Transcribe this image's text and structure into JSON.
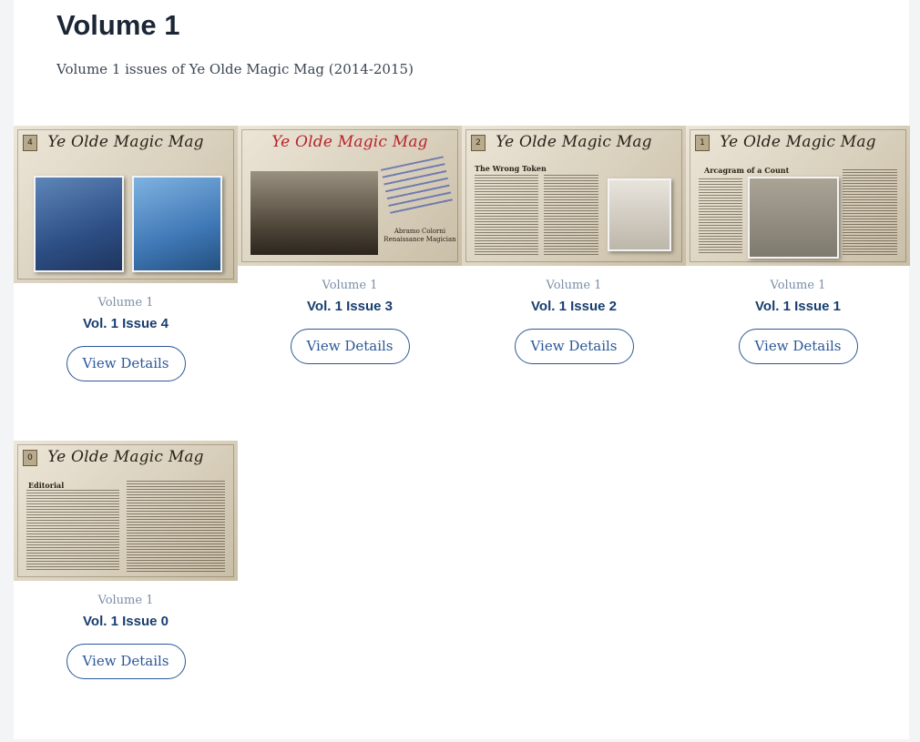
{
  "header": {
    "title": "Volume 1",
    "subtitle": "Volume 1 issues of Ye Olde Magic Mag (2014-2015)"
  },
  "cover_brand": "Ye Olde Magic Mag",
  "issues": [
    {
      "volume_label": "Volume 1",
      "title": "Vol. 1 Issue 4",
      "issue_number": "4",
      "button": "View Details"
    },
    {
      "volume_label": "Volume 1",
      "title": "Vol. 1 Issue 3",
      "issue_number": "3",
      "button": "View Details",
      "cover_caption": "Abramo Colorni Renaissance Magician"
    },
    {
      "volume_label": "Volume 1",
      "title": "Vol. 1 Issue 2",
      "issue_number": "2",
      "button": "View Details",
      "cover_heading": "The Wrong Token"
    },
    {
      "volume_label": "Volume 1",
      "title": "Vol. 1 Issue 1",
      "issue_number": "1",
      "button": "View Details",
      "cover_heading": "Arcagram of a Count"
    },
    {
      "volume_label": "Volume 1",
      "title": "Vol. 1 Issue 0",
      "issue_number": "0",
      "button": "View Details",
      "cover_heading": "Editorial"
    }
  ],
  "colors": {
    "heading": "#1b2636",
    "issue_title": "#173e6e",
    "volume_label": "#7a8ea8",
    "button_border": "#2b5797",
    "page_bg": "#f3f4f6"
  }
}
